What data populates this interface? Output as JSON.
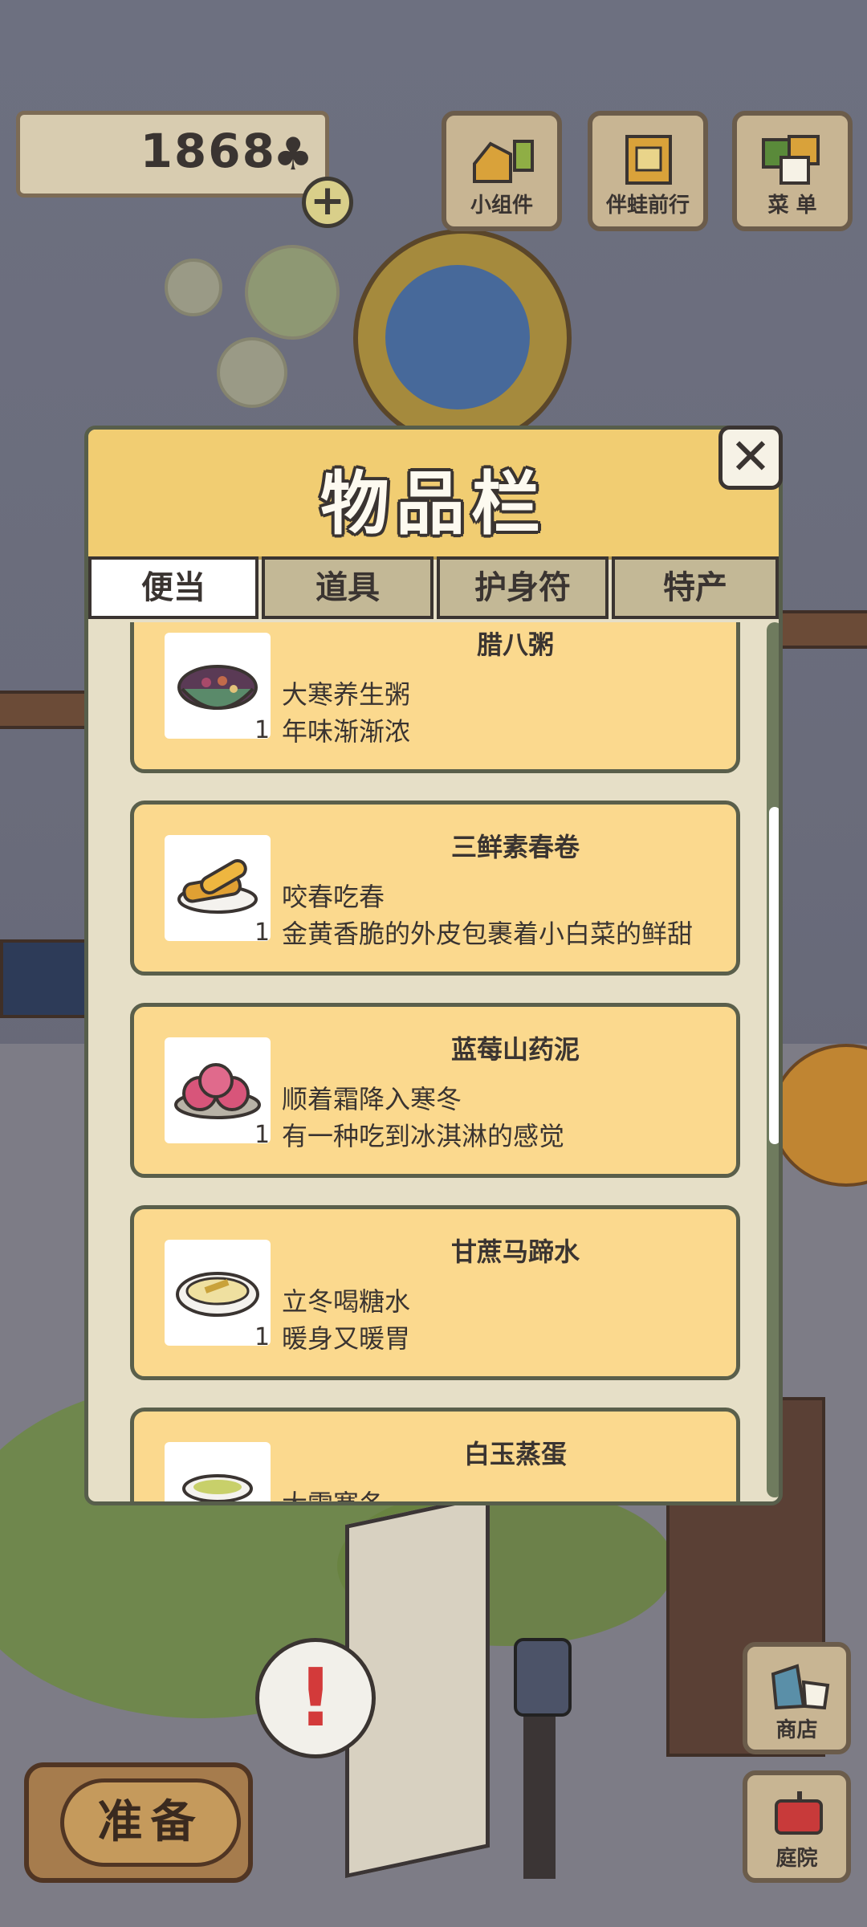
{
  "hud": {
    "clover_count": "1868",
    "clover_symbol": "♣",
    "plus_symbol": "+",
    "buttons": [
      {
        "label": "小组件",
        "icon": "widget-icon"
      },
      {
        "label": "伴蛙前行",
        "icon": "journal-icon"
      },
      {
        "label": "菜 单",
        "icon": "menu-icon"
      }
    ]
  },
  "bottom": {
    "prepare_label": "准备",
    "alert_symbol": "!",
    "shop_label": "商店",
    "yard_label": "庭院"
  },
  "inventory": {
    "title": "物品栏",
    "close_symbol": "✕",
    "tabs": [
      {
        "label": "便当",
        "active": true
      },
      {
        "label": "道具",
        "active": false
      },
      {
        "label": "护身符",
        "active": false
      },
      {
        "label": "特产",
        "active": false
      }
    ],
    "items": [
      {
        "name": "腊八粥",
        "line1": "大寒养生粥",
        "line2": "年味渐渐浓",
        "count": "1",
        "icon": "porridge-bowl-icon"
      },
      {
        "name": "三鲜素春卷",
        "line1": "咬春吃春",
        "line2": "金黄香脆的外皮包裹着小白菜的鲜甜",
        "count": "1",
        "icon": "spring-roll-icon"
      },
      {
        "name": "蓝莓山药泥",
        "line1": "顺着霜降入寒冬",
        "line2": "有一种吃到冰淇淋的感觉",
        "count": "1",
        "icon": "blueberry-yam-icon"
      },
      {
        "name": "甘蔗马蹄水",
        "line1": "立冬喝糖水",
        "line2": "暖身又暖胃",
        "count": "1",
        "icon": "sugarcane-soup-icon"
      },
      {
        "name": "白玉蒸蛋",
        "line1": "大雪寒冬",
        "line2": "",
        "count": "",
        "icon": "steamed-egg-icon"
      }
    ]
  },
  "colors": {
    "header_yellow": "#f1cd72",
    "card_yellow": "#fbd98e",
    "outline": "#3a3431"
  }
}
